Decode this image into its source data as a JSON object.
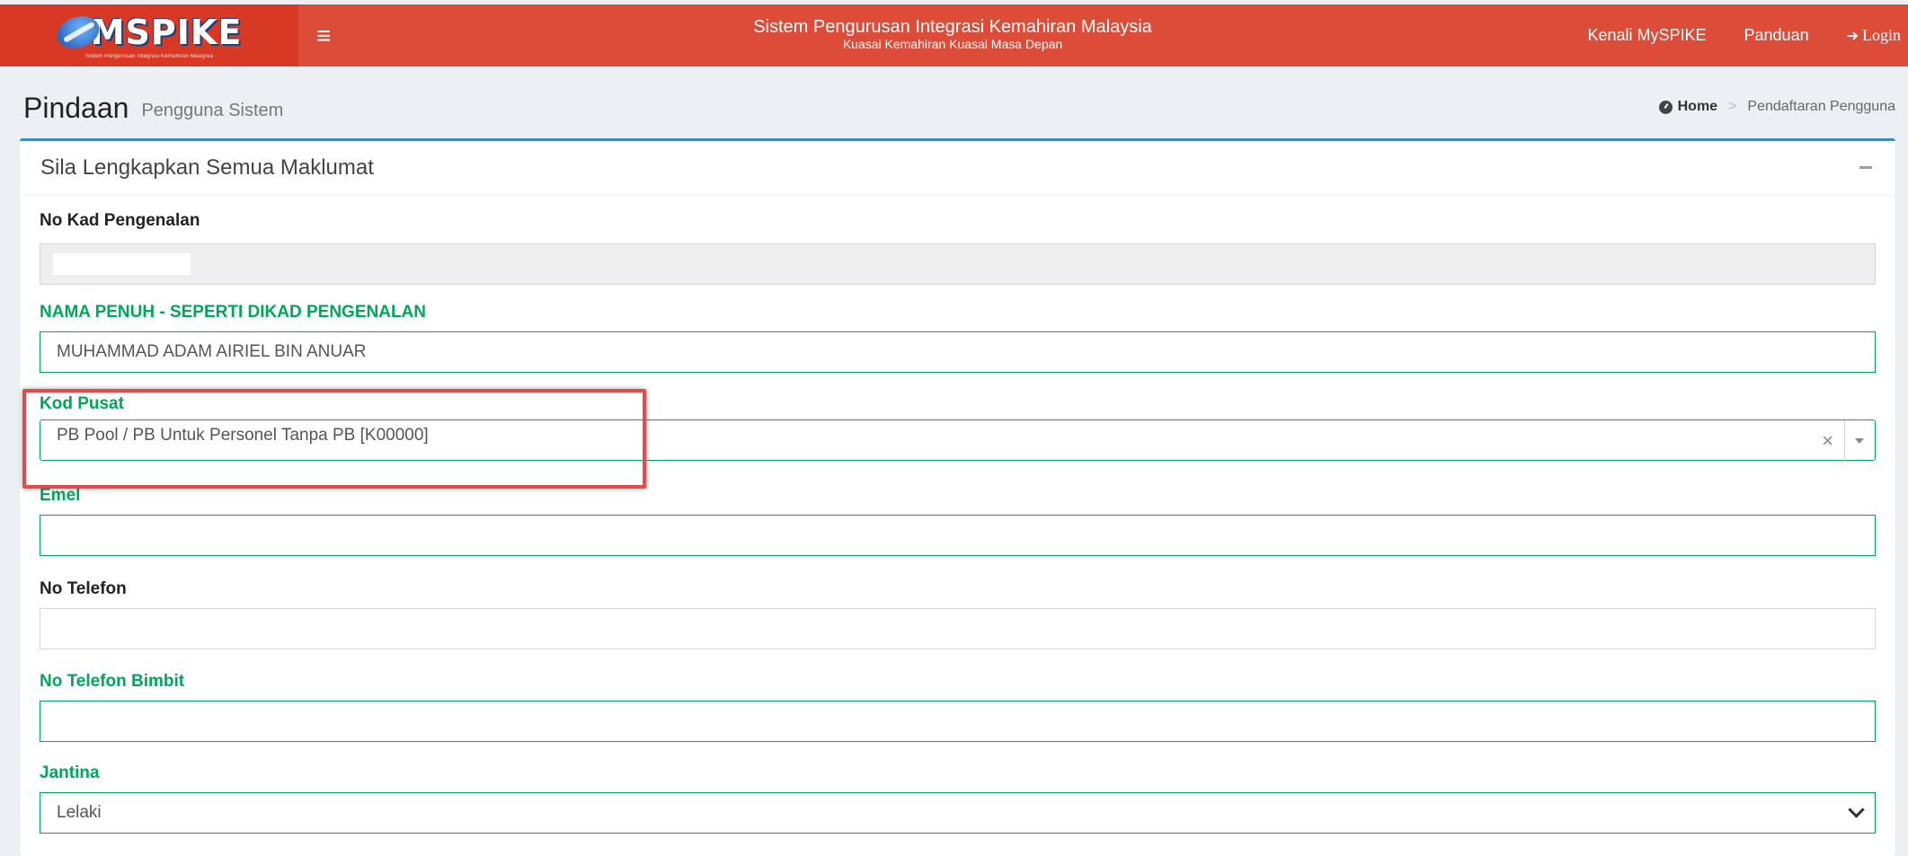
{
  "header": {
    "logo_text": "MSPIKE",
    "logo_tagline": "Sistem Pengurusan Integrasi Kemahiran Malaysia",
    "system_name": "Sistem Pengurusan Integrasi Kemahiran Malaysia",
    "tagline": "Kuasai Kemahiran Kuasai Masa Depan",
    "nav": {
      "about": "Kenali MySPIKE",
      "guide": "Panduan",
      "login": "Login"
    },
    "colors": {
      "primary": "#dd4b39",
      "logo_bg": "#d73925"
    },
    "icons": {
      "menu": "hamburger-icon",
      "login": "sign-in-icon"
    }
  },
  "content_header": {
    "title": "Pindaan",
    "subtitle": "Pengguna Sistem",
    "breadcrumb": {
      "home": "Home",
      "current": "Pendaftaran Pengguna"
    }
  },
  "form": {
    "box_title": "Sila Lengkapkan Semua Maklumat",
    "fields": {
      "ic": {
        "label": "No Kad Pengenalan",
        "value": ""
      },
      "name": {
        "label": "NAMA PENUH - SEPERTI DIKAD PENGENALAN",
        "value": "MUHAMMAD ADAM AIRIEL BIN ANUAR"
      },
      "center": {
        "label": "Kod Pusat",
        "value": "PB Pool / PB Untuk Personel Tanpa PB [K00000]",
        "clear": "×"
      },
      "email": {
        "label": "Emel",
        "value": ""
      },
      "phone": {
        "label": "No Telefon",
        "value": ""
      },
      "mobile": {
        "label": "No Telefon Bimbit",
        "value": ""
      },
      "gender": {
        "label": "Jantina",
        "value": "Lelaki"
      }
    },
    "colors": {
      "valid": "#00a65a",
      "box_top": "#3c8dbc",
      "annotation": "#e8484a"
    }
  }
}
